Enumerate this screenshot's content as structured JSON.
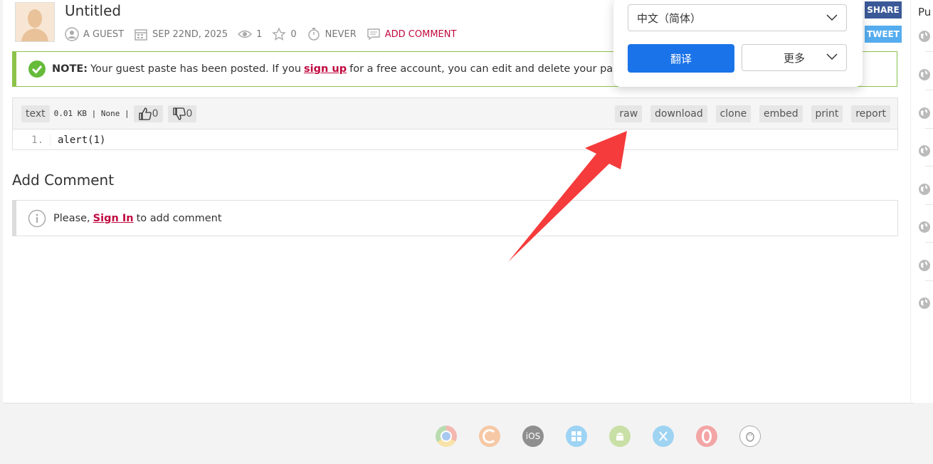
{
  "paste": {
    "title": "Untitled",
    "author": "A GUEST",
    "date": "SEP 22ND, 2025",
    "views": "1",
    "stars": "0",
    "expiry": "NEVER",
    "add_comment": "ADD COMMENT"
  },
  "social": {
    "share": "SHARE",
    "tweet": "TWEET"
  },
  "note": {
    "label": "NOTE:",
    "text_before": "Your guest paste has been posted. If you",
    "link": "sign up",
    "text_after": "for a free account, you can edit and delete your pastes!"
  },
  "code_header": {
    "syntax": "text",
    "info": "0.01 KB | None |",
    "likes": "0",
    "dislikes": "0",
    "actions": [
      "raw",
      "download",
      "clone",
      "embed",
      "print",
      "report"
    ]
  },
  "code": {
    "line_number": "1.",
    "line": "alert(1)"
  },
  "comments": {
    "title": "Add Comment",
    "before": "Please,",
    "link": "Sign In",
    "after": "to add comment"
  },
  "sidebar": {
    "heading": "Pu"
  },
  "translate_popup": {
    "language": "中文（简体）",
    "translate_button": "翻译",
    "more_button": "更多"
  },
  "footer": {
    "ios_label": "iOS"
  },
  "colors": {
    "accent": "#c0093f",
    "note_border": "#8bc34a",
    "translate_blue": "#1a73e8"
  }
}
